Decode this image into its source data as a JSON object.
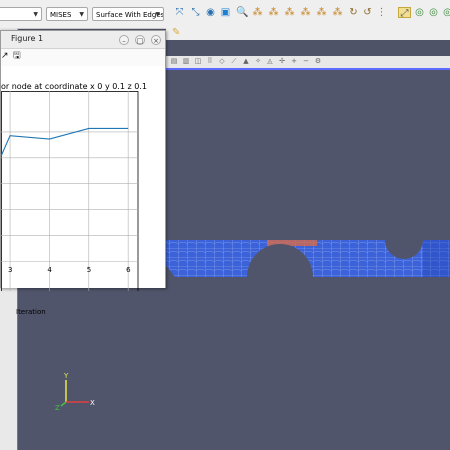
{
  "toolbar": {
    "variable_value": "MISES",
    "representation_value": "Surface With Edges"
  },
  "figure": {
    "window_title": "Figure 1",
    "min_glyph": "–",
    "max_glyph": "□",
    "close_glyph": "×",
    "plot_title": "or node at coordinate x 0 y 0.1 z 0.1",
    "xlabel": "Iteration"
  },
  "axes_labels": {
    "y": "Y",
    "x": "X",
    "z": "Z"
  },
  "chart_data": {
    "type": "line",
    "title": "or node at coordinate x 0 y 0.1 z 0.1",
    "xlabel": "Iteration",
    "ylabel": "",
    "x_ticks": [
      "3",
      "4",
      "5",
      "6"
    ],
    "xlim": [
      2.77,
      6.25
    ],
    "grid": true,
    "series": [
      {
        "x": [
          2.77,
          3.0,
          4.0,
          5.0,
          6.0
        ],
        "y": [
          0.33,
          0.95,
          0.85,
          1.17,
          1.17
        ]
      }
    ],
    "ylim": [
      -3.8,
      2.3
    ],
    "line_color": "#1f77b4"
  },
  "colors": {
    "viewport": "#50556b",
    "mesh_blue": "#3a5fd6",
    "highlight": "#d46a4a"
  }
}
